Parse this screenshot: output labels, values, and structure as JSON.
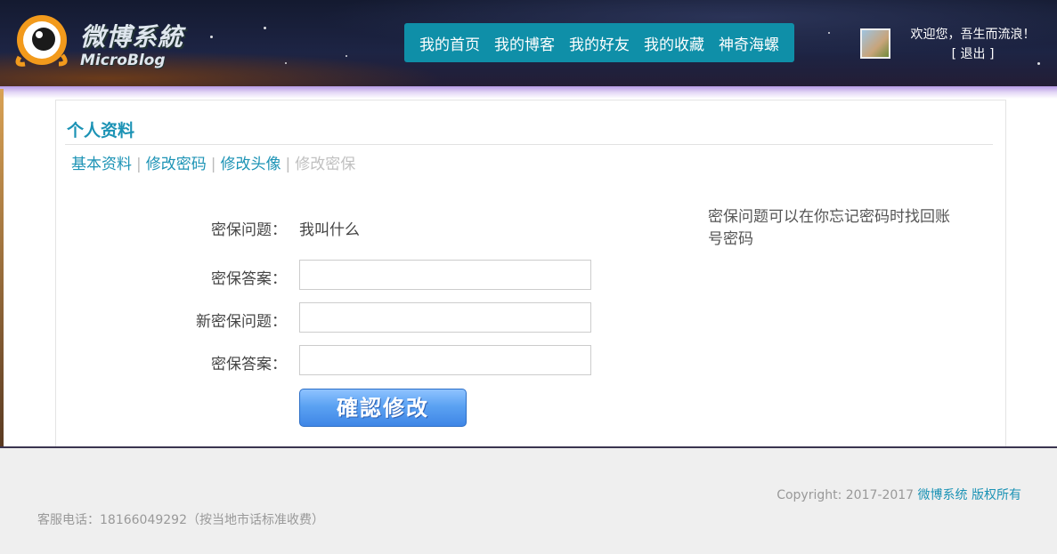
{
  "header": {
    "logo_cn": "微博系統",
    "logo_en": "MicroBlog",
    "nav": [
      "我的首页",
      "我的博客",
      "我的好友",
      "我的收藏",
      "神奇海螺"
    ],
    "welcome": "欢迎您，吾生而流浪！",
    "logout": "[ 退出 ]"
  },
  "panel": {
    "title": "个人资料",
    "tabs": [
      "基本资料",
      "修改密码",
      "修改头像",
      "修改密保"
    ],
    "active_tab": "修改密保",
    "tab_separator": "|"
  },
  "form": {
    "question_label": "密保问题：",
    "question_value": "我叫什么",
    "answer_label": "密保答案：",
    "answer_value": "",
    "new_question_label": "新密保问题：",
    "new_question_value": "",
    "new_answer_label": "密保答案：",
    "new_answer_value": "",
    "submit_label": "確認修改"
  },
  "hint": "密保问题可以在你忘记密码时找回账号密码",
  "footer": {
    "copyright_prefix": "Copyright: 2017-2017",
    "copyright_brand": "微博系统 版权所有",
    "hotline": "客服电话：18166049292（按当地市话标准收费）"
  },
  "colors": {
    "accent": "#1c93b5",
    "nav_bg": "#0f8fa8",
    "button_blue": "#5ba2f2"
  }
}
